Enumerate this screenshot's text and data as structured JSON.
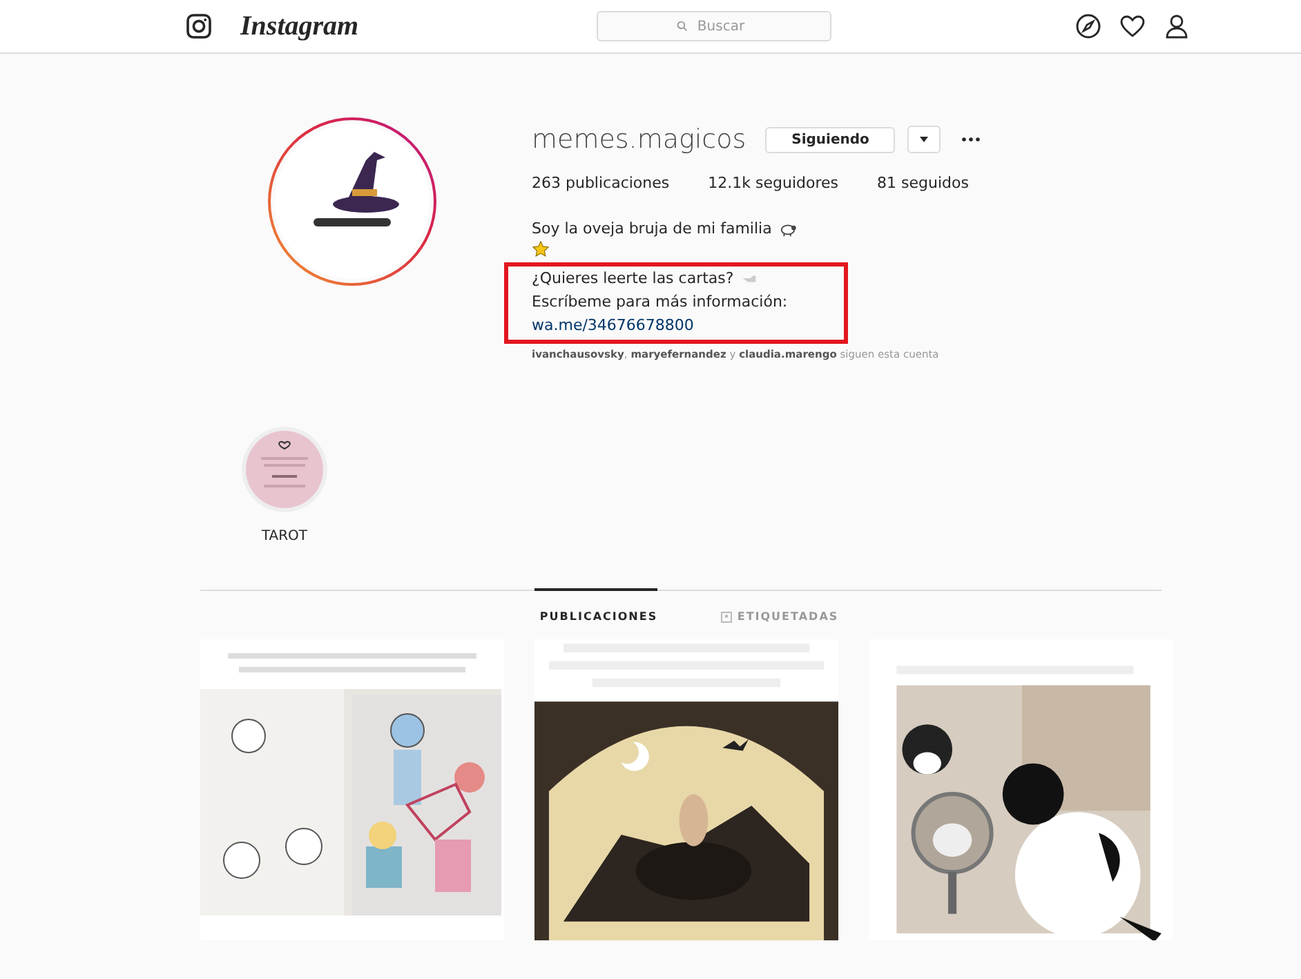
{
  "header": {
    "brand": "Instagram",
    "search": {
      "placeholder": "Buscar"
    }
  },
  "profile": {
    "username": "memes.magicos",
    "follow_button": "Siguiendo",
    "stats": [
      "263 publicaciones",
      "12.1k seguidores",
      "81 seguidos"
    ],
    "bio": [
      {
        "kind": "text",
        "text": "Soy la oveja bruja de mi familia"
      },
      {
        "kind": "emoji"
      }
    ],
    "framed_bio": [
      {
        "kind": "text",
        "text": "¿Quieres leerte las cartas?"
      },
      {
        "kind": "text",
        "text": "Escríbeme para más información:"
      },
      {
        "kind": "link",
        "text": "wa.me/34676678800"
      }
    ],
    "followed_by": "**ivanchausovsky**, **maryefernandez** y **claudia.marengo** siguen esta cuenta"
  },
  "highlights": [
    {
      "title": "TAROT"
    }
  ],
  "tabs": [
    {
      "label": "PUBLICACIONES",
      "selected": true
    },
    {
      "label": "ETIQUETADAS",
      "selected": false
    }
  ]
}
